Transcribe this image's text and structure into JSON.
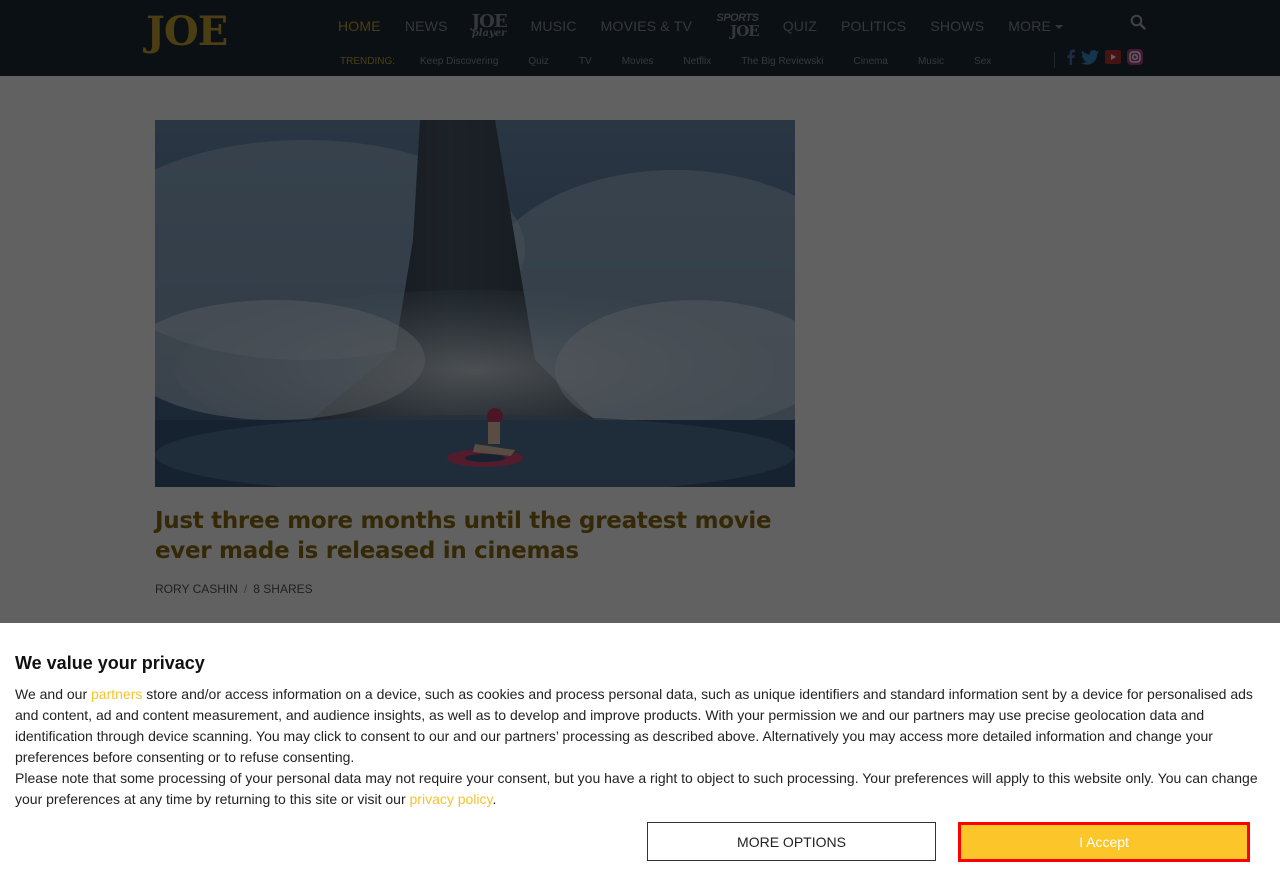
{
  "brand": {
    "logo": "JOE",
    "accent": "#c9a233",
    "nav_bg": "#1e2a38"
  },
  "nav": {
    "home": "HOME",
    "news": "NEWS",
    "joe_player_big": "JOE",
    "joe_player_small": "player",
    "music": "MUSIC",
    "movies_tv": "MOVIES & TV",
    "sports_top": "SPORTS",
    "sports_bottom": "JOE",
    "quiz": "QUIZ",
    "politics": "POLITICS",
    "shows": "SHOWS",
    "more": "MORE",
    "search_icon": "search-icon"
  },
  "trending": {
    "label": "TRENDING:",
    "items": [
      "Keep Discovering",
      "Quiz",
      "TV",
      "Movies",
      "Netflix",
      "The Big Reviewski",
      "Cinema",
      "Music",
      "Sex"
    ]
  },
  "socials": [
    "facebook-icon",
    "twitter-icon",
    "youtube-icon",
    "instagram-icon"
  ],
  "article": {
    "title": "Just three more months until the greatest movie ever made is released in cinemas",
    "author": "RORY CASHIN",
    "shares": "8 SHARES"
  },
  "consent": {
    "heading": "We value your privacy",
    "p1_before": "We and our ",
    "p1_link": "partners",
    "p1_after": " store and/or access information on a device, such as cookies and process personal data, such as unique identifiers and standard information sent by a device for personalised ads and content, ad and content measurement, and audience insights, as well as to develop and improve products. With your permission we and our partners may use precise geolocation data and identification through device scanning. You may click to consent to our and our partners’ processing as described above. Alternatively you may access more detailed information and change your preferences before consenting or to refuse consenting.",
    "p2_before": "Please note that some processing of your personal data may not require your consent, but you have a right to object to such processing. Your preferences will apply to this website only. You can change your preferences at any time by returning to this site or visit our ",
    "p2_link": "privacy policy",
    "p2_after": ".",
    "more_options": "MORE OPTIONS",
    "accept": "I Accept",
    "accept_color": "#fcc62b",
    "link_color": "#f5c32c"
  }
}
